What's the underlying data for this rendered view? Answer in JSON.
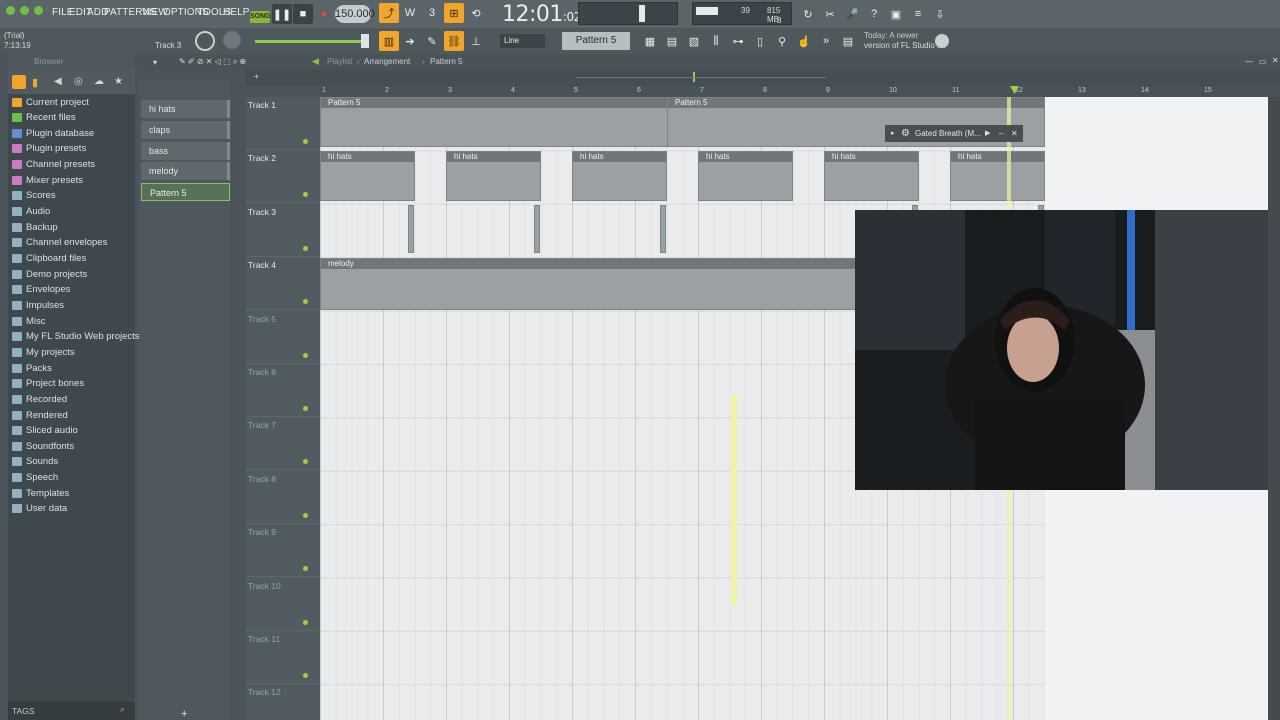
{
  "menu": [
    "FILE",
    "EDIT",
    "ADD",
    "PATTERNS",
    "VIEW",
    "OPTIONS",
    "TOOLS",
    "HELP"
  ],
  "song_mode": "SONG",
  "tempo": "150.000",
  "clock": {
    "main": "12:01",
    "sub": "02"
  },
  "status": {
    "trial": "(Trial)",
    "time": "7:13:19",
    "track": "Track 3"
  },
  "cpu": {
    "val": "39",
    "mem": "815 MB",
    "poly": "8"
  },
  "news": {
    "line1": "Today: A newer",
    "line2": "version of FL Studio i..."
  },
  "toolbar2": {
    "snap": "Line",
    "pattern": "Pattern 5"
  },
  "browser": {
    "title": "Browser",
    "items": [
      "Current project",
      "Recent files",
      "Plugin database",
      "Plugin presets",
      "Channel presets",
      "Mixer presets",
      "Scores",
      "Audio",
      "Backup",
      "Channel envelopes",
      "Clipboard files",
      "Demo projects",
      "Envelopes",
      "Impulses",
      "Misc",
      "My FL Studio Web projects",
      "My projects",
      "Packs",
      "Project bones",
      "Recorded",
      "Rendered",
      "Sliced audio",
      "Soundfonts",
      "Sounds",
      "Speech",
      "Templates",
      "User data"
    ],
    "tags": "TAGS"
  },
  "patterns": [
    "hi hats",
    "claps",
    "bass",
    "melody",
    "Pattern 5"
  ],
  "playlist": {
    "title": "Playlist",
    "crumb1": "Arrangement",
    "crumb2": "Pattern 5"
  },
  "ruler": [
    "1",
    "2",
    "3",
    "4",
    "5",
    "6",
    "7",
    "8",
    "9",
    "10",
    "11",
    "12",
    "13",
    "14",
    "15"
  ],
  "tracks": [
    "Track 1",
    "Track 2",
    "Track 3",
    "Track 4",
    "Track 5",
    "Track 6",
    "Track 7",
    "Track 8",
    "Track 9",
    "Track 10",
    "Track 11",
    "Track 12"
  ],
  "clips": {
    "pattern5": "Pattern 5",
    "hihats": "hi hats",
    "melody": "melody"
  },
  "plugin_window": "Gated Breath (M...",
  "colors": {
    "accent": "#f0a52d",
    "green": "#9ad14a",
    "grid": "#e9ebec"
  }
}
